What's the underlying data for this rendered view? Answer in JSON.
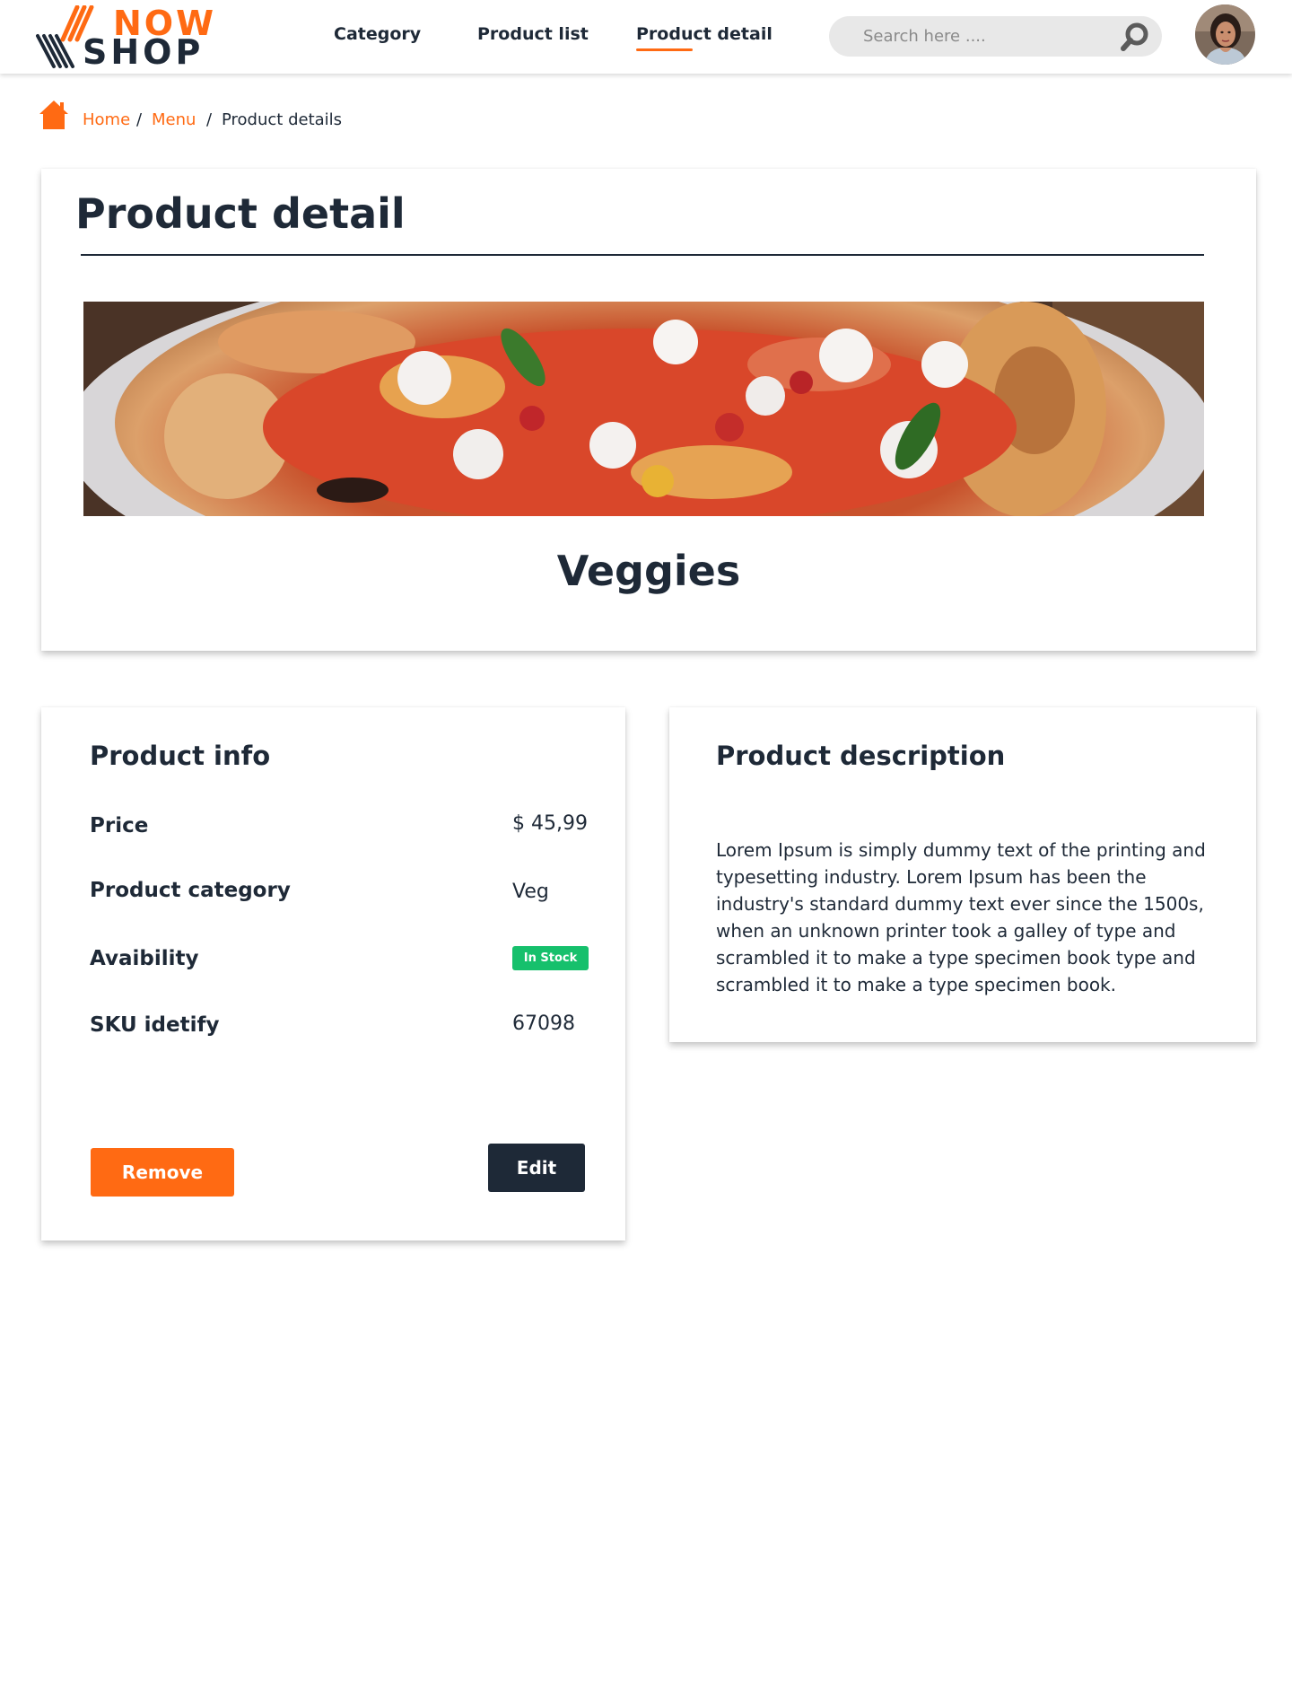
{
  "header": {
    "logo": {
      "top": "NOW",
      "bottom": "SHOP"
    },
    "nav": [
      {
        "label": "Category"
      },
      {
        "label": "Product list"
      },
      {
        "label": "Product detail",
        "active": true
      }
    ],
    "search": {
      "placeholder": "Search here ....",
      "value": "",
      "icon": "search-icon"
    },
    "avatar": {
      "icon": "user-avatar"
    }
  },
  "breadcrumb": {
    "icon": "home-icon",
    "items": [
      {
        "label": "Home"
      },
      {
        "label": "Menu"
      },
      {
        "label": "Product details"
      }
    ],
    "separator": "/"
  },
  "product": {
    "page_title": "Product detail",
    "name": "Veggies"
  },
  "info": {
    "title": "Product info",
    "rows": [
      {
        "label": "Price",
        "value": "$ 45,99"
      },
      {
        "label": "Product category",
        "value": "Veg"
      },
      {
        "label": "Avaibility",
        "value": "In Stock"
      },
      {
        "label": "SKU idetify",
        "value": "67098"
      }
    ],
    "remove_label": "Remove",
    "edit_label": "Edit"
  },
  "description": {
    "title": "Product description",
    "text": "Lorem Ipsum is simply dummy text of the printing and typesetting industry. Lorem Ipsum has been the industry's standard dummy text ever since the 1500s, when an unknown printer took a galley of type and scrambled it to make a type specimen book type and scrambled it to make a type specimen book."
  },
  "colors": {
    "accent": "#ff6a13",
    "dark": "#1e2937",
    "success": "#16c06c",
    "search_bg": "#e8e8e8"
  }
}
